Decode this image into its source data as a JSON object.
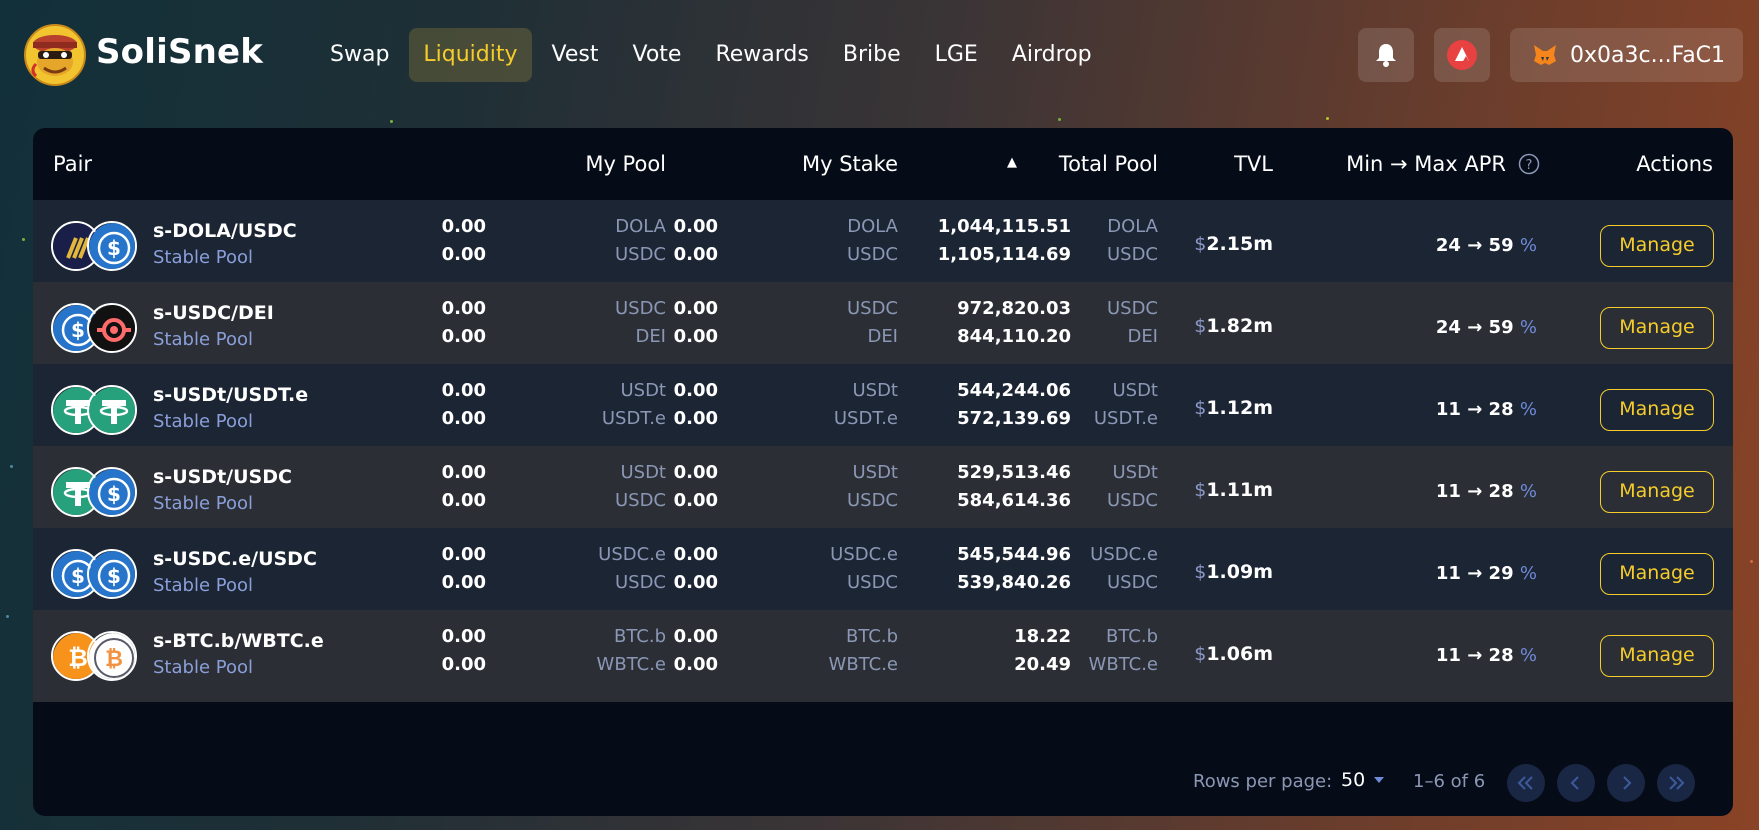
{
  "app": {
    "brand": "SoliSnek"
  },
  "nav": [
    "Swap",
    "Liquidity",
    "Vest",
    "Vote",
    "Rewards",
    "Bribe",
    "LGE",
    "Airdrop"
  ],
  "wallet": {
    "address": "0x0a3c...FaC1"
  },
  "table": {
    "headers": {
      "pair": "Pair",
      "my_pool": "My Pool",
      "my_stake": "My Stake",
      "total_pool": "Total Pool",
      "tvl": "TVL",
      "apr": "Min → Max APR",
      "actions": "Actions"
    },
    "sort_indicator": "▲",
    "manage_label": "Manage",
    "rows": [
      {
        "name": "s-DOLA/USDC",
        "type": "Stable Pool",
        "t1": "DOLA",
        "t2": "USDC",
        "mp1": "0.00",
        "mp2": "0.00",
        "ms1": "0.00",
        "ms2": "0.00",
        "tp1": "1,044,115.51",
        "tp2": "1,105,114.69",
        "tvl": "2.15m",
        "apr": "24 → 59",
        "c1": "dola",
        "c2": "usdc"
      },
      {
        "name": "s-USDC/DEI",
        "type": "Stable Pool",
        "t1": "USDC",
        "t2": "DEI",
        "mp1": "0.00",
        "mp2": "0.00",
        "ms1": "0.00",
        "ms2": "0.00",
        "tp1": "972,820.03",
        "tp2": "844,110.20",
        "tvl": "1.82m",
        "apr": "24 → 59",
        "c1": "usdc",
        "c2": "dei"
      },
      {
        "name": "s-USDt/USDT.e",
        "type": "Stable Pool",
        "t1": "USDt",
        "t2": "USDT.e",
        "mp1": "0.00",
        "mp2": "0.00",
        "ms1": "0.00",
        "ms2": "0.00",
        "tp1": "544,244.06",
        "tp2": "572,139.69",
        "tvl": "1.12m",
        "apr": "11 → 28",
        "c1": "usdt",
        "c2": "usdt"
      },
      {
        "name": "s-USDt/USDC",
        "type": "Stable Pool",
        "t1": "USDt",
        "t2": "USDC",
        "mp1": "0.00",
        "mp2": "0.00",
        "ms1": "0.00",
        "ms2": "0.00",
        "tp1": "529,513.46",
        "tp2": "584,614.36",
        "tvl": "1.11m",
        "apr": "11 → 28",
        "c1": "usdt",
        "c2": "usdc"
      },
      {
        "name": "s-USDC.e/USDC",
        "type": "Stable Pool",
        "t1": "USDC.e",
        "t2": "USDC",
        "mp1": "0.00",
        "mp2": "0.00",
        "ms1": "0.00",
        "ms2": "0.00",
        "tp1": "545,544.96",
        "tp2": "539,840.26",
        "tvl": "1.09m",
        "apr": "11 → 29",
        "c1": "usdc",
        "c2": "usdc"
      },
      {
        "name": "s-BTC.b/WBTC.e",
        "type": "Stable Pool",
        "t1": "BTC.b",
        "t2": "WBTC.e",
        "mp1": "0.00",
        "mp2": "0.00",
        "ms1": "0.00",
        "ms2": "0.00",
        "tp1": "18.22",
        "tp2": "20.49",
        "tvl": "1.06m",
        "apr": "11 → 28",
        "c1": "btc",
        "c2": "wbtc"
      }
    ]
  },
  "footer": {
    "rows_per_page_label": "Rows per page:",
    "rows_per_page_value": "50",
    "range": "1–6 of 6"
  },
  "colors": {
    "accent": "#f5cc2b",
    "panel": "#060c17",
    "row_odd": "#1c2533",
    "row_even": "#2b2f35",
    "muted_token": "#8b97b5",
    "pool_type": "#8a9fda"
  }
}
